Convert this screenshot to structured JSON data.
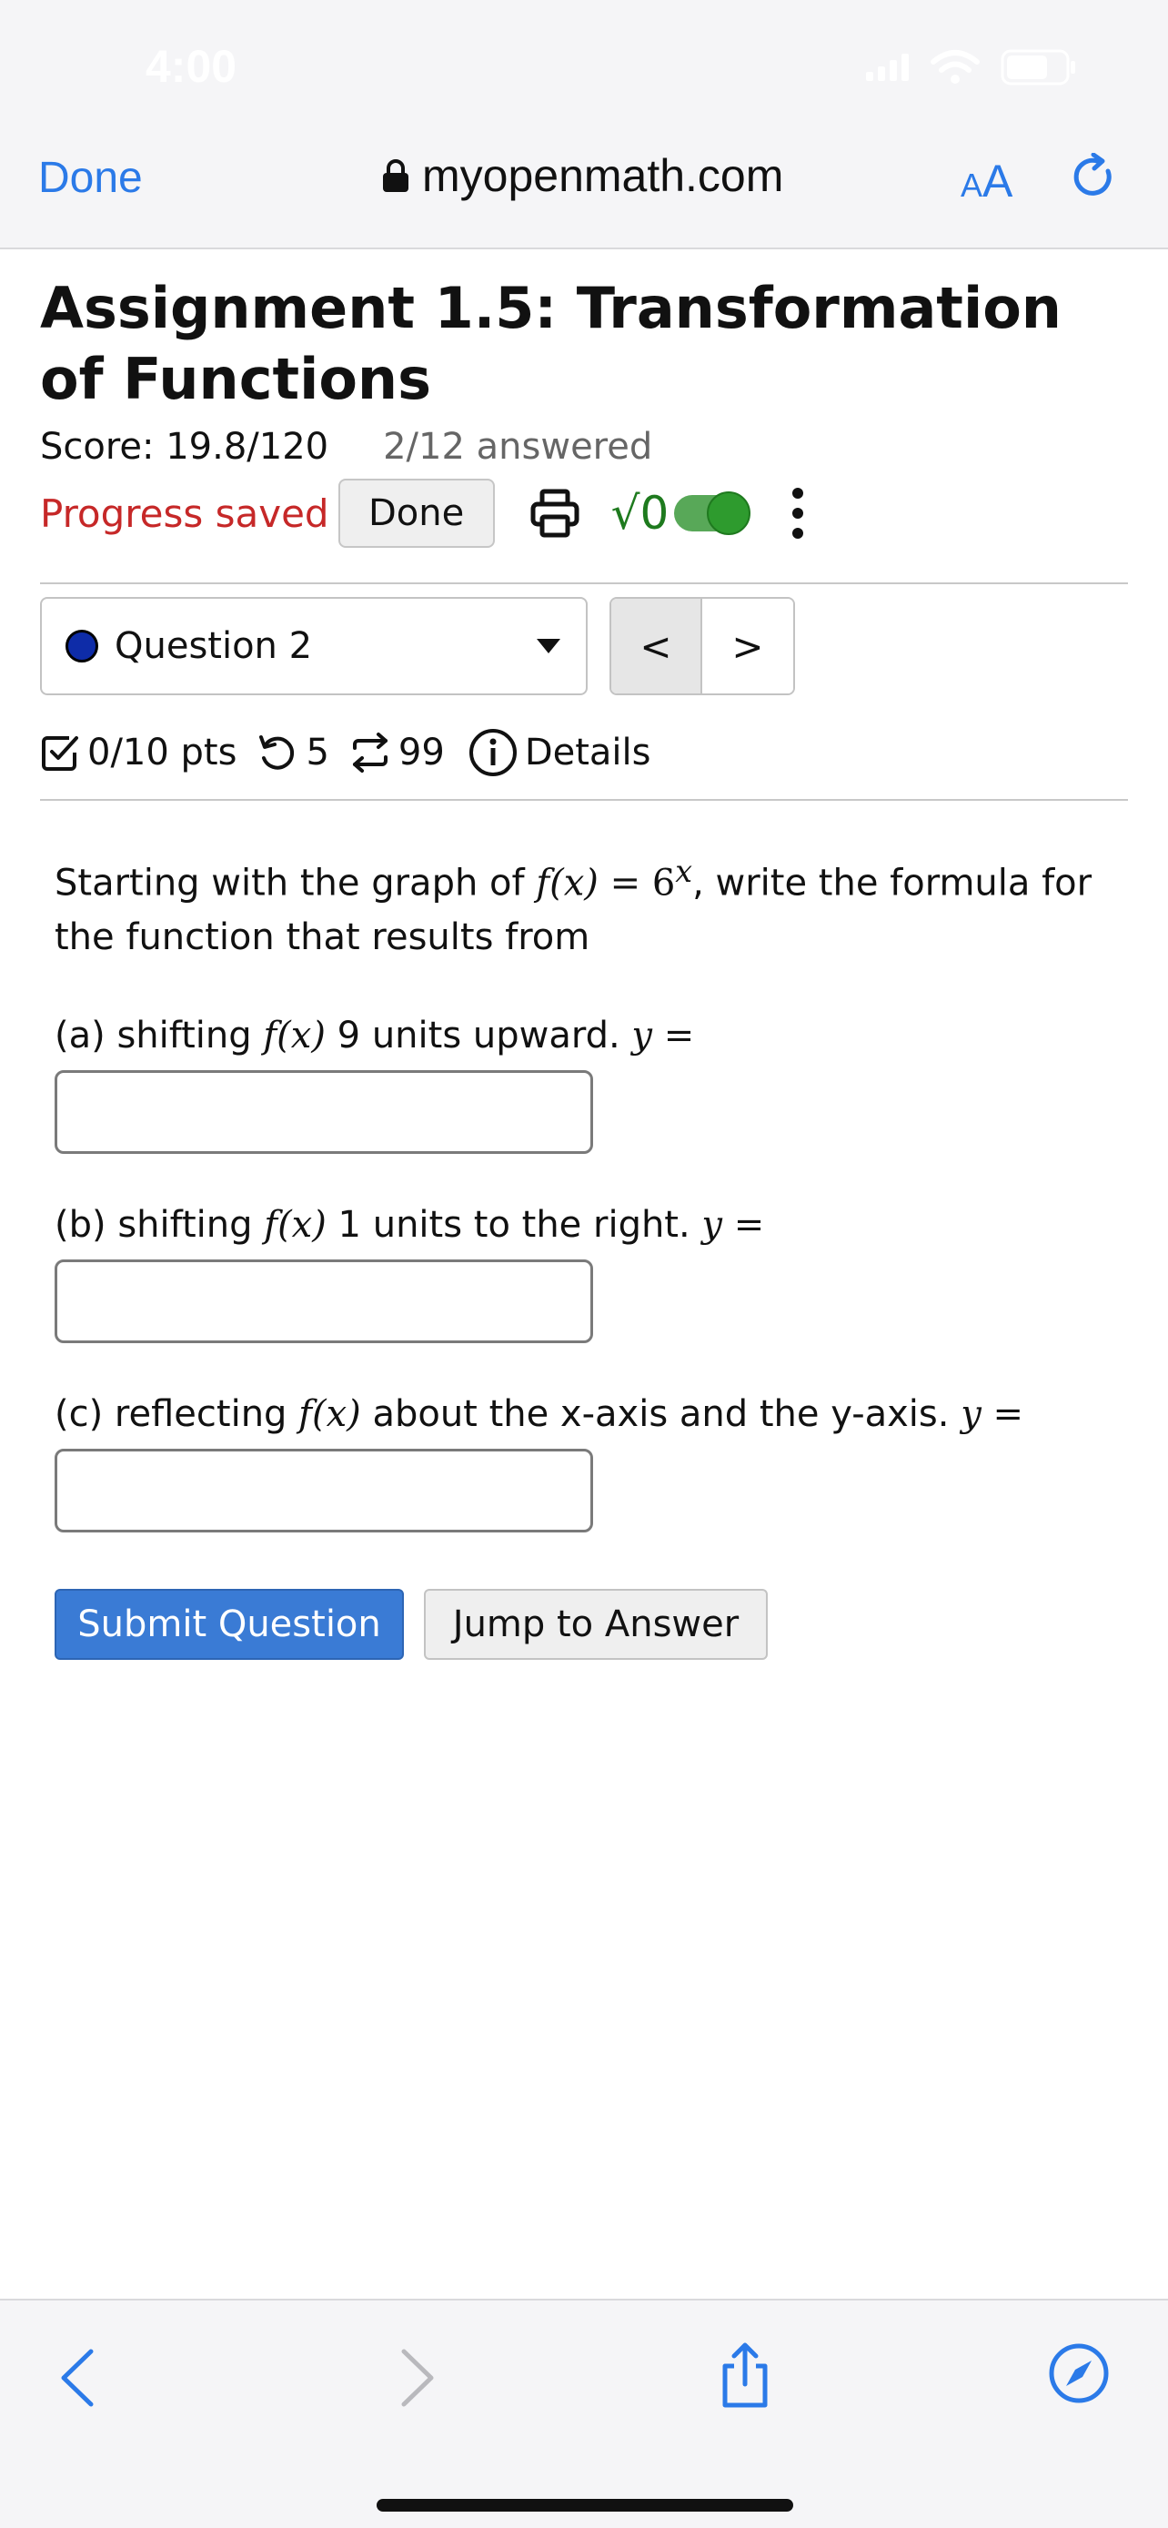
{
  "status_bar": {
    "time": "4:00"
  },
  "browser": {
    "done_label": "Done",
    "url": "myopenmath.com",
    "text_size_small": "A",
    "text_size_large": "A"
  },
  "assignment": {
    "title": "Assignment 1.5: Transformation of Functions",
    "score": "Score: 19.8/120",
    "answered": "2/12 answered",
    "progress": "Progress saved",
    "done_button": "Done",
    "math_toggle_label": "√0"
  },
  "question_nav": {
    "selected": "Question 2",
    "prev": "<",
    "next": ">"
  },
  "question_meta": {
    "points": "0/10 pts",
    "retries": "5",
    "attempts": "99",
    "details": "Details"
  },
  "question": {
    "intro_1": "Starting with the graph of ",
    "intro_fx": "f(x)",
    "intro_eq": " = 6",
    "intro_exp": "x",
    "intro_2": ", write the formula for the function that results from",
    "parts": [
      {
        "prefix": "(a) shifting ",
        "fx": "f(x)",
        "suffix": " 9 units upward. ",
        "y": "y =",
        "value": ""
      },
      {
        "prefix": "(b) shifting ",
        "fx": "f(x)",
        "suffix": " 1 units to the right. ",
        "y": "y =",
        "value": ""
      },
      {
        "prefix": "(c) reflecting ",
        "fx": "f(x)",
        "suffix": " about the x-axis and the y-axis. ",
        "y": "y =",
        "value": ""
      }
    ],
    "submit_label": "Submit Question",
    "jump_label": "Jump to Answer"
  },
  "colors": {
    "accent_blue": "#2b7ae8",
    "progress_red": "#c62828",
    "submit_blue": "#3a7bd5",
    "toggle_green": "#2e9b2e"
  },
  "icons": [
    "lock-icon",
    "reload-icon",
    "print-icon",
    "more-vertical-icon",
    "checkbox-icon",
    "retry-icon",
    "attempts-icon",
    "info-icon",
    "back-icon",
    "forward-icon",
    "share-icon",
    "compass-icon"
  ]
}
